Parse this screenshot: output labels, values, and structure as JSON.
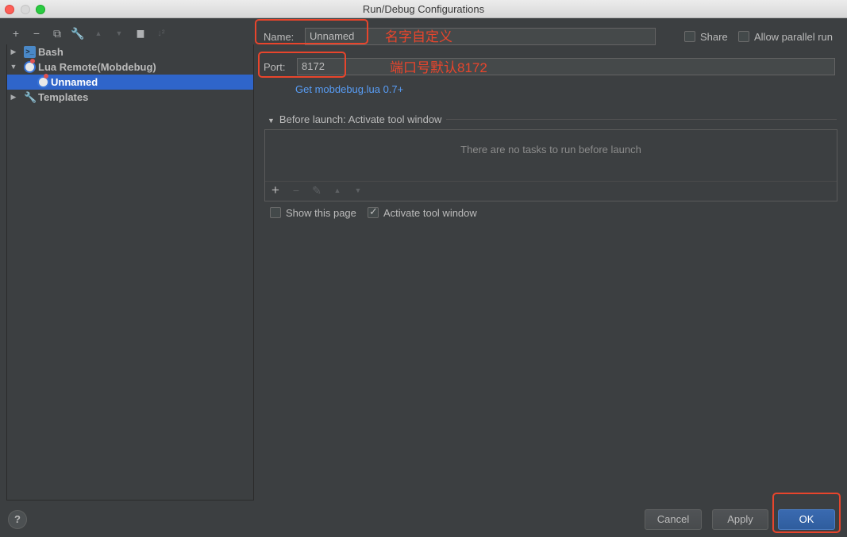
{
  "window": {
    "title": "Run/Debug Configurations"
  },
  "toolbar": {
    "add": "+",
    "remove": "−",
    "copy": "⧉",
    "edit": "🔧",
    "move_up": "▲",
    "move_down": "▼",
    "folder": "▆",
    "sort": "↓²"
  },
  "tree": {
    "items": [
      {
        "label": "Bash",
        "icon": "bash-icon",
        "expanded": false
      },
      {
        "label": "Lua Remote(Mobdebug)",
        "icon": "lua-icon",
        "expanded": true
      },
      {
        "label": "Unnamed",
        "icon": "lua-icon",
        "selected": true
      },
      {
        "label": "Templates",
        "icon": "wrench-icon",
        "expanded": false
      }
    ]
  },
  "form": {
    "name_label": "Name:",
    "name_value": "Unnamed",
    "share_label": "Share",
    "parallel_label": "Allow parallel run",
    "port_label": "Port:",
    "port_value": "8172",
    "link_text": "Get mobdebug.lua 0.7+"
  },
  "annotations": {
    "name_note": "名字自定义",
    "port_note": "端口号默认8172",
    "color": "#e8452c"
  },
  "before_launch": {
    "title": "Before launch: Activate tool window",
    "empty_text": "There are no tasks to run before launch",
    "tools": {
      "add": "+",
      "remove": "−",
      "edit": "✎",
      "up": "▲",
      "down": "▼"
    }
  },
  "options": {
    "show_page_label": "Show this page",
    "show_page_checked": false,
    "activate_label": "Activate tool window",
    "activate_checked": true
  },
  "buttons": {
    "help": "?",
    "cancel": "Cancel",
    "apply": "Apply",
    "ok": "OK"
  },
  "colors": {
    "selection": "#2f65ca",
    "link": "#589df6",
    "background": "#3c3f41"
  }
}
